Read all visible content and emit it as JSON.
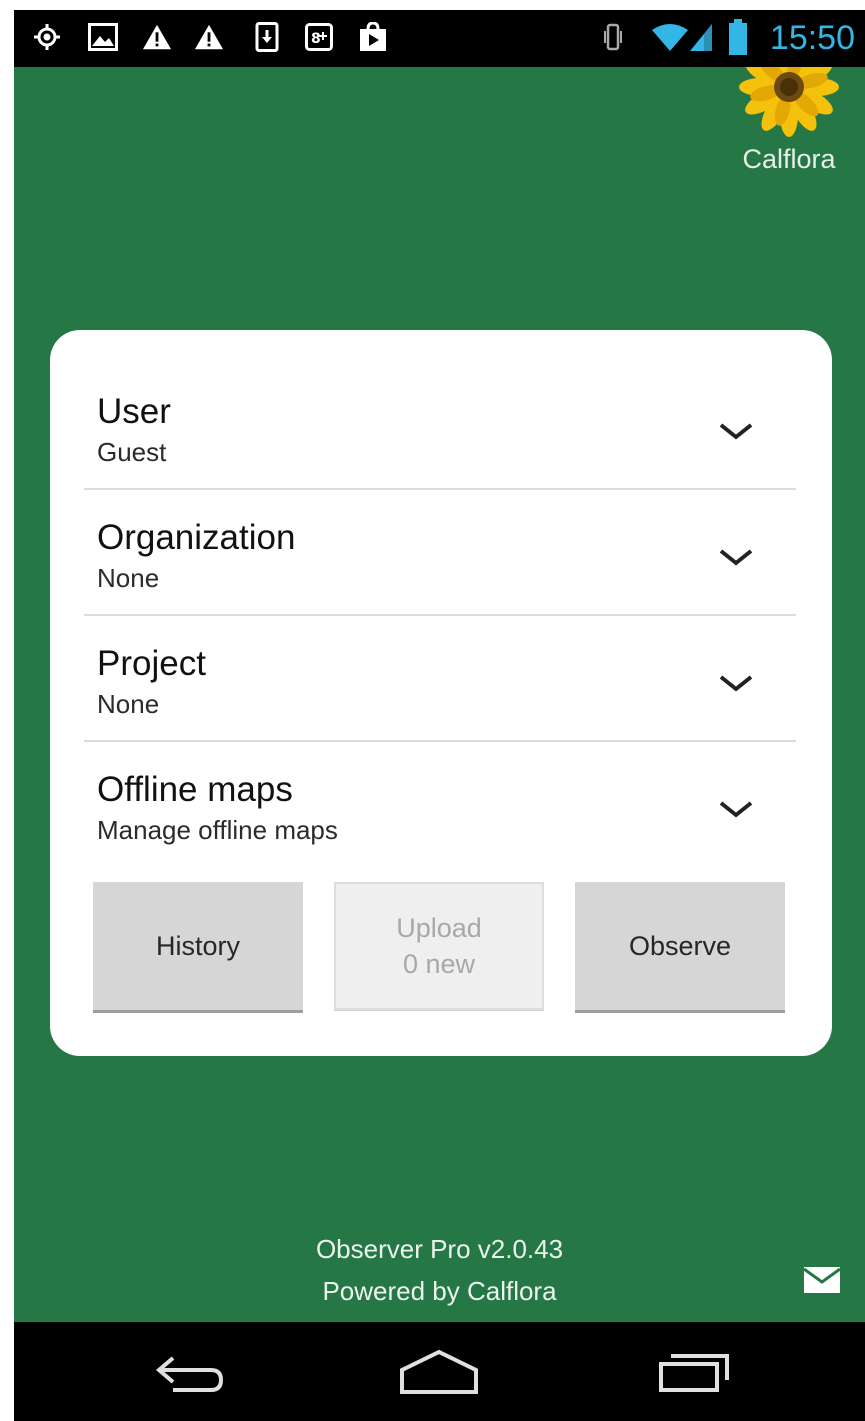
{
  "status_bar": {
    "time": "15:50",
    "left_icons": [
      "gps-icon",
      "image-notification-icon",
      "warning-icon",
      "warning-icon",
      "download-icon",
      "google-plus-icon",
      "play-store-icon"
    ],
    "right_icons": [
      "vibrate-icon",
      "wifi-icon",
      "signal-icon",
      "battery-icon"
    ],
    "time_color": "#33b5e5"
  },
  "header": {
    "logo_label": "Calflora"
  },
  "settings": [
    {
      "title": "User",
      "value": "Guest"
    },
    {
      "title": "Organization",
      "value": "None"
    },
    {
      "title": "Project",
      "value": "None"
    },
    {
      "title": "Offline maps",
      "value": "Manage offline maps"
    }
  ],
  "buttons": {
    "history": "History",
    "upload_line1": "Upload",
    "upload_line2": "0 new",
    "observe": "Observe"
  },
  "footer": {
    "version": "Observer Pro v2.0.43",
    "powered_by": "Powered by Calflora"
  },
  "colors": {
    "background": "#257845",
    "accent": "#33b5e5"
  }
}
